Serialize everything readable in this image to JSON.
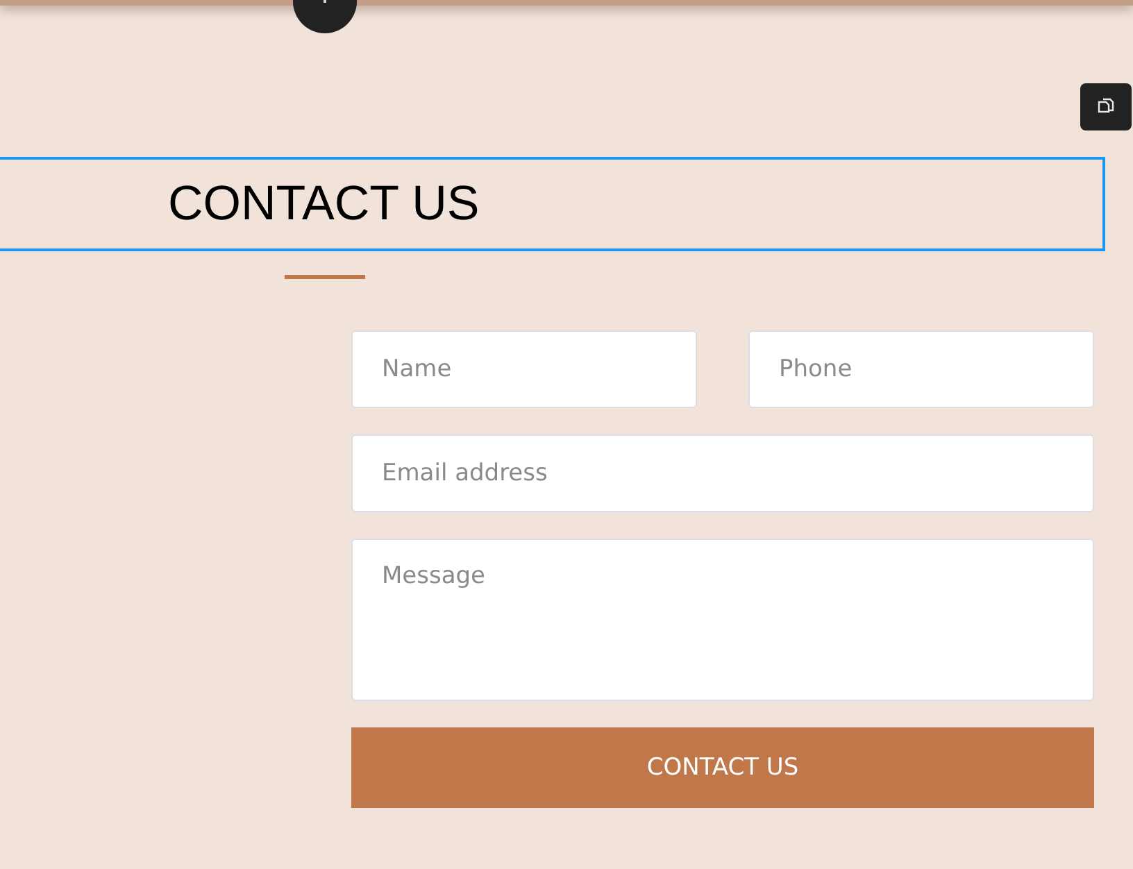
{
  "heading": {
    "title": "CONTACT US"
  },
  "form": {
    "fields": [
      {
        "kind": "input",
        "placeholder": "Name"
      },
      {
        "kind": "input",
        "placeholder": "Phone"
      },
      {
        "kind": "input",
        "placeholder": "Email address"
      },
      {
        "kind": "textarea",
        "placeholder": "Message"
      }
    ],
    "submit": "CONTACT US"
  }
}
